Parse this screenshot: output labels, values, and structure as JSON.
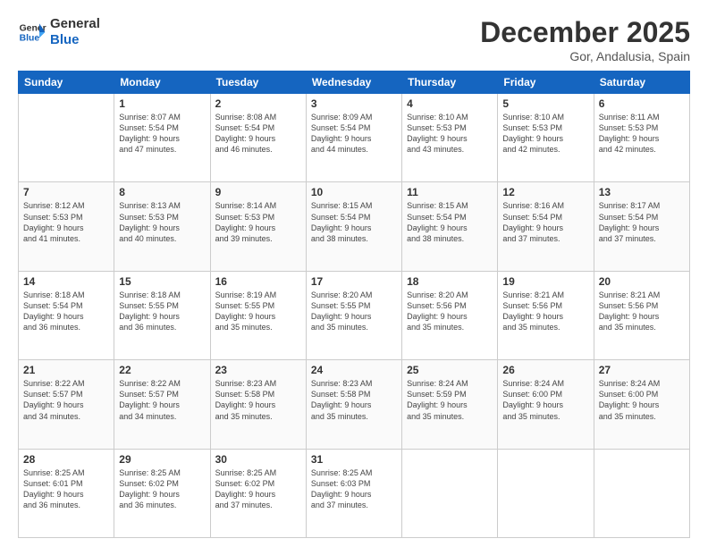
{
  "header": {
    "logo_line1": "General",
    "logo_line2": "Blue",
    "month_title": "December 2025",
    "location": "Gor, Andalusia, Spain"
  },
  "weekdays": [
    "Sunday",
    "Monday",
    "Tuesday",
    "Wednesday",
    "Thursday",
    "Friday",
    "Saturday"
  ],
  "weeks": [
    [
      {
        "day": "",
        "info": ""
      },
      {
        "day": "1",
        "info": "Sunrise: 8:07 AM\nSunset: 5:54 PM\nDaylight: 9 hours\nand 47 minutes."
      },
      {
        "day": "2",
        "info": "Sunrise: 8:08 AM\nSunset: 5:54 PM\nDaylight: 9 hours\nand 46 minutes."
      },
      {
        "day": "3",
        "info": "Sunrise: 8:09 AM\nSunset: 5:54 PM\nDaylight: 9 hours\nand 44 minutes."
      },
      {
        "day": "4",
        "info": "Sunrise: 8:10 AM\nSunset: 5:53 PM\nDaylight: 9 hours\nand 43 minutes."
      },
      {
        "day": "5",
        "info": "Sunrise: 8:10 AM\nSunset: 5:53 PM\nDaylight: 9 hours\nand 42 minutes."
      },
      {
        "day": "6",
        "info": "Sunrise: 8:11 AM\nSunset: 5:53 PM\nDaylight: 9 hours\nand 42 minutes."
      }
    ],
    [
      {
        "day": "7",
        "info": "Sunrise: 8:12 AM\nSunset: 5:53 PM\nDaylight: 9 hours\nand 41 minutes."
      },
      {
        "day": "8",
        "info": "Sunrise: 8:13 AM\nSunset: 5:53 PM\nDaylight: 9 hours\nand 40 minutes."
      },
      {
        "day": "9",
        "info": "Sunrise: 8:14 AM\nSunset: 5:53 PM\nDaylight: 9 hours\nand 39 minutes."
      },
      {
        "day": "10",
        "info": "Sunrise: 8:15 AM\nSunset: 5:54 PM\nDaylight: 9 hours\nand 38 minutes."
      },
      {
        "day": "11",
        "info": "Sunrise: 8:15 AM\nSunset: 5:54 PM\nDaylight: 9 hours\nand 38 minutes."
      },
      {
        "day": "12",
        "info": "Sunrise: 8:16 AM\nSunset: 5:54 PM\nDaylight: 9 hours\nand 37 minutes."
      },
      {
        "day": "13",
        "info": "Sunrise: 8:17 AM\nSunset: 5:54 PM\nDaylight: 9 hours\nand 37 minutes."
      }
    ],
    [
      {
        "day": "14",
        "info": "Sunrise: 8:18 AM\nSunset: 5:54 PM\nDaylight: 9 hours\nand 36 minutes."
      },
      {
        "day": "15",
        "info": "Sunrise: 8:18 AM\nSunset: 5:55 PM\nDaylight: 9 hours\nand 36 minutes."
      },
      {
        "day": "16",
        "info": "Sunrise: 8:19 AM\nSunset: 5:55 PM\nDaylight: 9 hours\nand 35 minutes."
      },
      {
        "day": "17",
        "info": "Sunrise: 8:20 AM\nSunset: 5:55 PM\nDaylight: 9 hours\nand 35 minutes."
      },
      {
        "day": "18",
        "info": "Sunrise: 8:20 AM\nSunset: 5:56 PM\nDaylight: 9 hours\nand 35 minutes."
      },
      {
        "day": "19",
        "info": "Sunrise: 8:21 AM\nSunset: 5:56 PM\nDaylight: 9 hours\nand 35 minutes."
      },
      {
        "day": "20",
        "info": "Sunrise: 8:21 AM\nSunset: 5:56 PM\nDaylight: 9 hours\nand 35 minutes."
      }
    ],
    [
      {
        "day": "21",
        "info": "Sunrise: 8:22 AM\nSunset: 5:57 PM\nDaylight: 9 hours\nand 34 minutes."
      },
      {
        "day": "22",
        "info": "Sunrise: 8:22 AM\nSunset: 5:57 PM\nDaylight: 9 hours\nand 34 minutes."
      },
      {
        "day": "23",
        "info": "Sunrise: 8:23 AM\nSunset: 5:58 PM\nDaylight: 9 hours\nand 35 minutes."
      },
      {
        "day": "24",
        "info": "Sunrise: 8:23 AM\nSunset: 5:58 PM\nDaylight: 9 hours\nand 35 minutes."
      },
      {
        "day": "25",
        "info": "Sunrise: 8:24 AM\nSunset: 5:59 PM\nDaylight: 9 hours\nand 35 minutes."
      },
      {
        "day": "26",
        "info": "Sunrise: 8:24 AM\nSunset: 6:00 PM\nDaylight: 9 hours\nand 35 minutes."
      },
      {
        "day": "27",
        "info": "Sunrise: 8:24 AM\nSunset: 6:00 PM\nDaylight: 9 hours\nand 35 minutes."
      }
    ],
    [
      {
        "day": "28",
        "info": "Sunrise: 8:25 AM\nSunset: 6:01 PM\nDaylight: 9 hours\nand 36 minutes."
      },
      {
        "day": "29",
        "info": "Sunrise: 8:25 AM\nSunset: 6:02 PM\nDaylight: 9 hours\nand 36 minutes."
      },
      {
        "day": "30",
        "info": "Sunrise: 8:25 AM\nSunset: 6:02 PM\nDaylight: 9 hours\nand 37 minutes."
      },
      {
        "day": "31",
        "info": "Sunrise: 8:25 AM\nSunset: 6:03 PM\nDaylight: 9 hours\nand 37 minutes."
      },
      {
        "day": "",
        "info": ""
      },
      {
        "day": "",
        "info": ""
      },
      {
        "day": "",
        "info": ""
      }
    ]
  ]
}
